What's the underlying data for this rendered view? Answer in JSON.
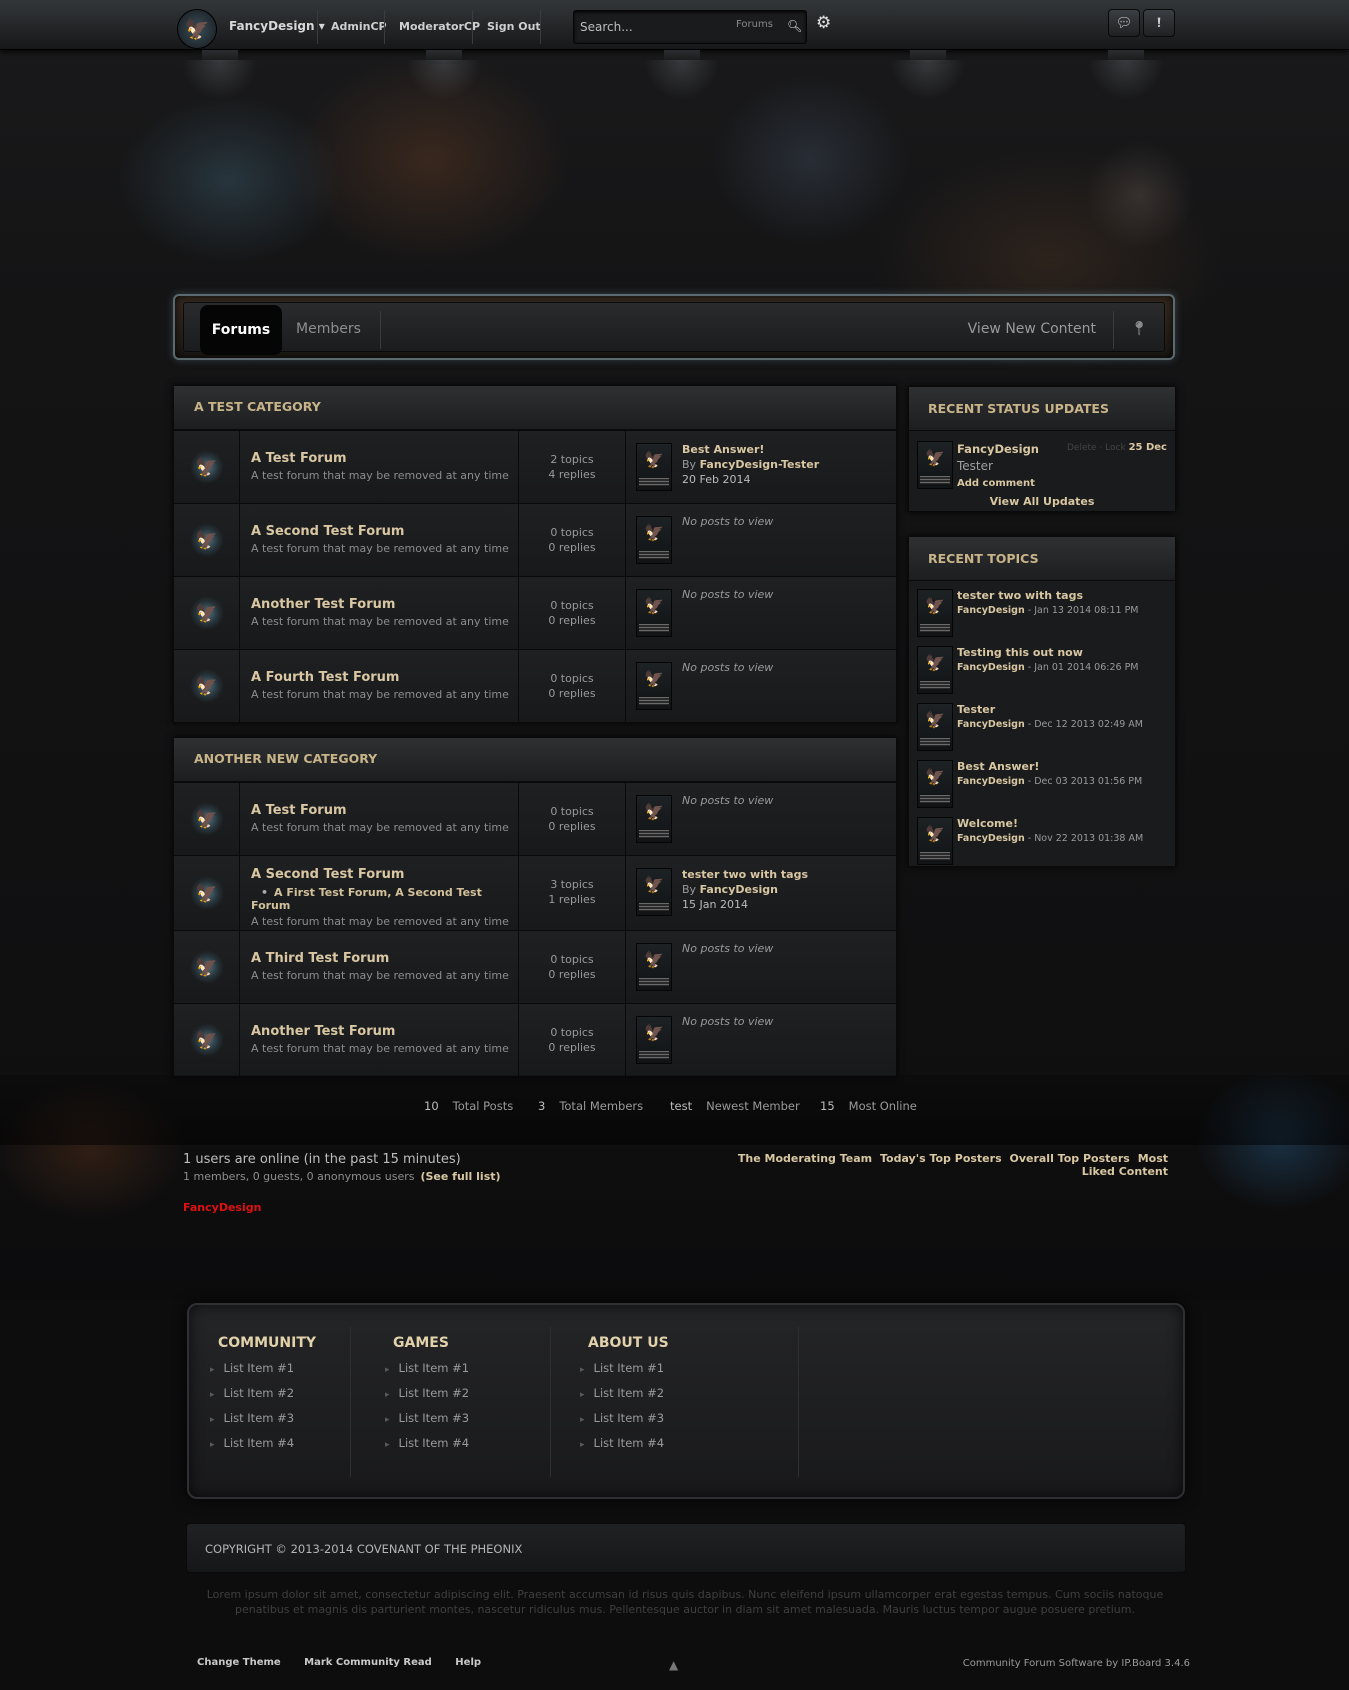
{
  "topbar": {
    "username": "FancyDesign ▾",
    "links": [
      "AdminCP",
      "ModeratorCP",
      "Sign Out"
    ],
    "search": {
      "placeholder": "Search...",
      "scope": "Forums"
    }
  },
  "mainnav": {
    "tabs": [
      "Forums",
      "Members"
    ],
    "right_link": "View New Content"
  },
  "categories": [
    {
      "title": "A TEST CATEGORY",
      "forums": [
        {
          "name": "A Test Forum",
          "desc": "A test forum that may be removed at any time",
          "topics": "2 topics",
          "replies": "4 replies",
          "last_title": "Best Answer!",
          "last_by_prefix": "By ",
          "last_by": "FancyDesign-Tester",
          "last_date": "20 Feb 2014"
        },
        {
          "name": "A Second Test Forum",
          "desc": "A test forum that may be removed at any time",
          "topics": "0 topics",
          "replies": "0 replies",
          "no_posts": "No posts to view"
        },
        {
          "name": "Another Test Forum",
          "desc": "A test forum that may be removed at any time",
          "topics": "0 topics",
          "replies": "0 replies",
          "no_posts": "No posts to view"
        },
        {
          "name": "A Fourth Test Forum",
          "desc": "A test forum that may be removed at any time",
          "topics": "0 topics",
          "replies": "0 replies",
          "no_posts": "No posts to view"
        }
      ]
    },
    {
      "title": "ANOTHER NEW CATEGORY",
      "forums": [
        {
          "name": "A Test Forum",
          "desc": "A test forum that may be removed at any time",
          "topics": "0 topics",
          "replies": "0 replies",
          "no_posts": "No posts to view"
        },
        {
          "name": "A Second Test Forum",
          "subforums": "A First Test Forum, A Second Test Forum",
          "desc": "A test forum that may be removed at any time",
          "topics": "3 topics",
          "replies": "1 replies",
          "last_title": "tester two with tags",
          "last_by_prefix": "By ",
          "last_by": "FancyDesign",
          "last_date": "15 Jan 2014"
        },
        {
          "name": "A Third Test Forum",
          "desc": "A test forum that may be removed at any time",
          "topics": "0 topics",
          "replies": "0 replies",
          "no_posts": "No posts to view"
        },
        {
          "name": "Another Test Forum",
          "desc": "A test forum that may be removed at any time",
          "topics": "0 topics",
          "replies": "0 replies",
          "no_posts": "No posts to view"
        }
      ]
    }
  ],
  "sidebar": {
    "status": {
      "title": "RECENT STATUS UPDATES",
      "name": "FancyDesign",
      "actions": "Delete · Lock",
      "date": "25 Dec",
      "text": "Tester",
      "comment": "Add comment",
      "view_all": "View All Updates"
    },
    "topics": {
      "title": "RECENT TOPICS",
      "items": [
        {
          "title": "tester two with tags",
          "author": "FancyDesign",
          "date": " - Jan 13 2014 08:11 PM"
        },
        {
          "title": "Testing this out now",
          "author": "FancyDesign",
          "date": " - Jan 01 2014 06:26 PM"
        },
        {
          "title": "Tester",
          "author": "FancyDesign",
          "date": " - Dec 12 2013 02:49 AM"
        },
        {
          "title": "Best Answer!",
          "author": "FancyDesign",
          "date": " - Dec 03 2013 01:56 PM"
        },
        {
          "title": "Welcome!",
          "author": "FancyDesign",
          "date": " - Nov 22 2013 01:38 AM"
        }
      ]
    }
  },
  "stats": [
    {
      "num": "10",
      "label": "Total Posts"
    },
    {
      "num": "3",
      "label": "Total Members"
    },
    {
      "num": "test",
      "label": "Newest Member"
    },
    {
      "num": "15",
      "label": "Most Online"
    }
  ],
  "online": {
    "title": "1 users are online (in the past 15 minutes)",
    "sub": "1 members, 0 guests, 0 anonymous users",
    "full_list": "(See full list)",
    "user": "FancyDesign",
    "leader_links": [
      "The Moderating Team",
      "Today's Top Posters",
      "Overall Top Posters",
      "Most Liked Content"
    ]
  },
  "footer": {
    "columns": [
      {
        "title": "COMMUNITY",
        "items": [
          "List Item #1",
          "List Item #2",
          "List Item #3",
          "List Item #4"
        ]
      },
      {
        "title": "GAMES",
        "items": [
          "List Item #1",
          "List Item #2",
          "List Item #3",
          "List Item #4"
        ]
      },
      {
        "title": "ABOUT US",
        "items": [
          "List Item #1",
          "List Item #2",
          "List Item #3",
          "List Item #4"
        ]
      }
    ],
    "copyright": "COPYRIGHT © 2013-2014 COVENANT OF THE PHEONIX",
    "lorem": "Lorem ipsum dolor sit amet, consectetur adipiscing elit. Praesent accumsan id risus quis dapibus. Nunc eleifend ipsum ullamcorper erat egestas tempus. Cum sociis natoque penatibus et magnis dis parturient montes, nascetur ridiculus mus. Pellentesque auctor in diam sit amet malesuada. Mauris luctus tempor augue posuere pretium.",
    "bottom_links": [
      "Change Theme",
      "Mark Community Read",
      "Help"
    ],
    "powered": "Community Forum Software by IP.Board 3.4.6"
  }
}
